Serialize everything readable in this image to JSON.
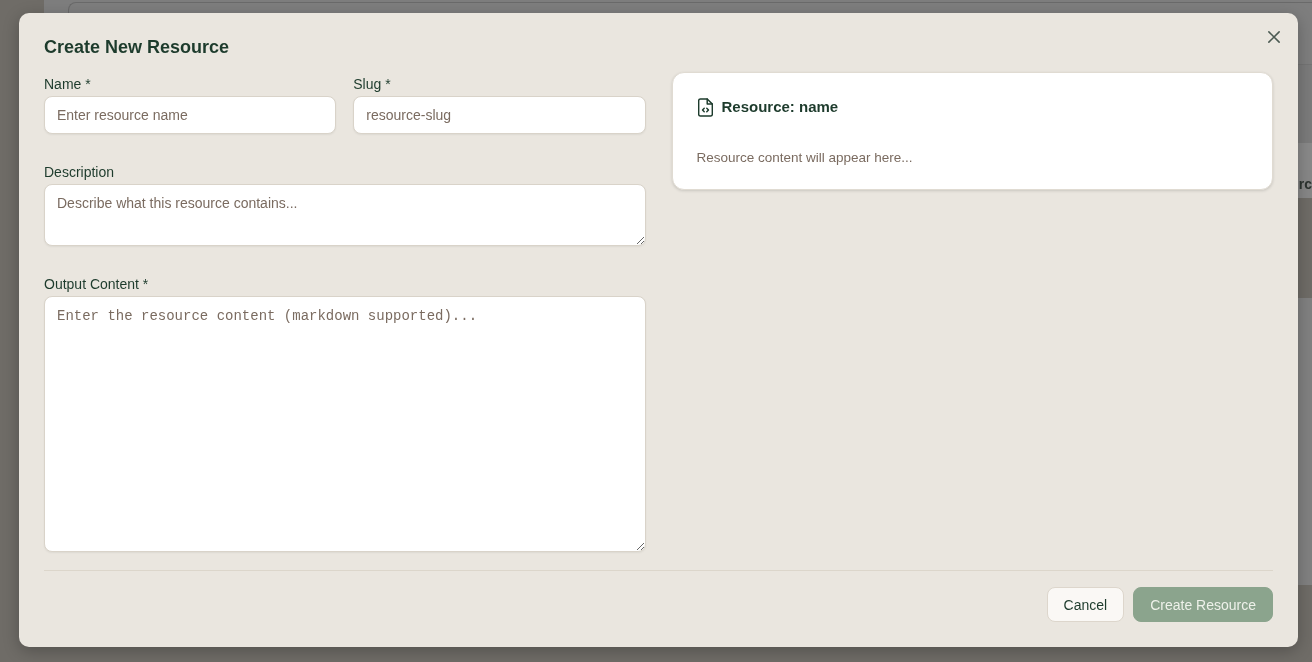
{
  "backdrop": {
    "text_fragment": "rc"
  },
  "dialog": {
    "title": "Create New Resource"
  },
  "fields": [
    {
      "label": "Name *",
      "kind": "input",
      "placeholder": "Enter resource name"
    },
    {
      "label": "Slug *",
      "kind": "input",
      "placeholder": "resource-slug"
    },
    {
      "label": "Description",
      "kind": "textarea",
      "placeholder": "Describe what this resource contains..."
    },
    {
      "label": "Output Content *",
      "kind": "code",
      "placeholder": "Enter the resource content (markdown supported)..."
    }
  ],
  "preview": {
    "title": "Resource: name",
    "body": "Resource content will appear here..."
  },
  "buttons": [
    {
      "label": "Cancel",
      "kind": "secondary",
      "disabled": false
    },
    {
      "label": "Create Resource",
      "kind": "primary",
      "disabled": true
    }
  ]
}
